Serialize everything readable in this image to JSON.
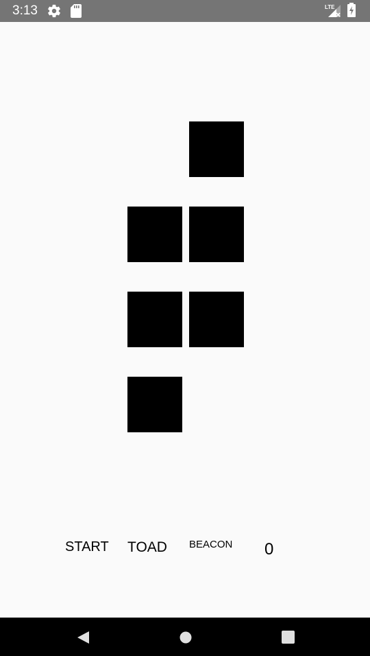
{
  "status_bar": {
    "time": "3:13",
    "network_label": "LTE",
    "icons": [
      "gear-icon",
      "sd-card-icon",
      "signal-icon",
      "battery-icon"
    ]
  },
  "board": {
    "cell_color": "#000000",
    "background": "#fafafa"
  },
  "controls": {
    "start_label": "START",
    "toad_label": "TOAD",
    "beacon_label": "BEACON",
    "generation_count": "0"
  },
  "nav_bar": {
    "icons": [
      "back-icon",
      "home-icon",
      "recents-icon"
    ]
  }
}
